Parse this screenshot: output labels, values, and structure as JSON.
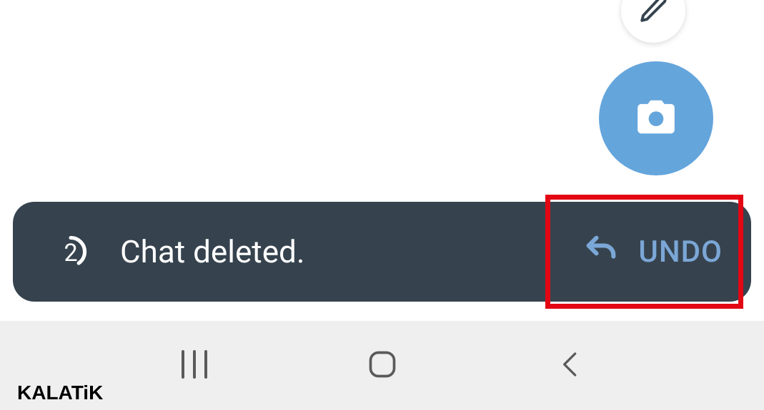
{
  "fab": {
    "edit_icon": "pencil-icon",
    "camera_icon": "camera-icon"
  },
  "snackbar": {
    "countdown": "2",
    "message": "Chat deleted.",
    "undo_label": "UNDO",
    "undo_icon": "undo-icon"
  },
  "navbar": {
    "recents_icon": "recents-icon",
    "home_icon": "home-icon",
    "back_icon": "back-icon"
  },
  "watermark": "KALATiK"
}
